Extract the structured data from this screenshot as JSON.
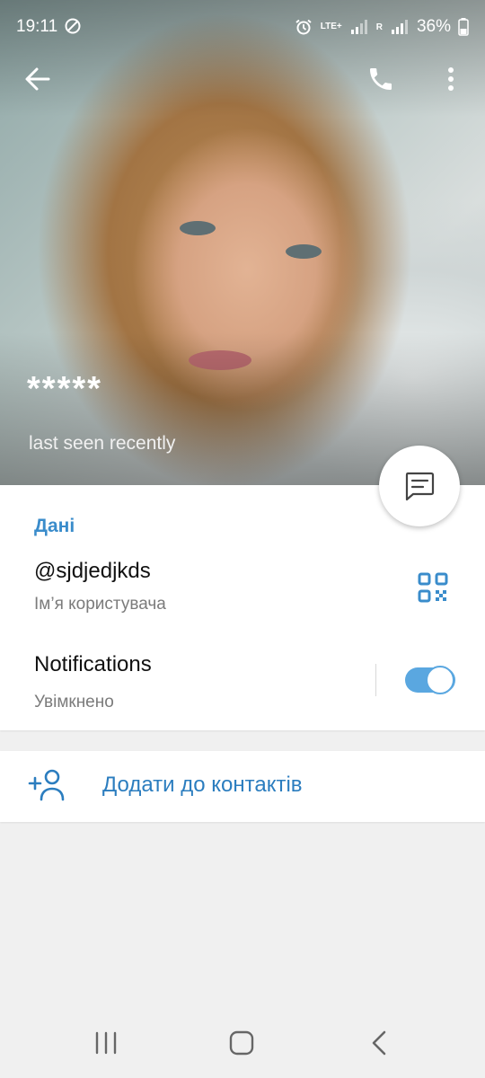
{
  "status_bar": {
    "time": "19:11",
    "network_label": "LTE+",
    "roaming_label": "R",
    "battery_percent": "36%",
    "icons": [
      "do-not-disturb-icon",
      "alarm-icon",
      "signal-icon",
      "battery-icon"
    ]
  },
  "toolbar": {
    "back_icon": "arrow-left-icon",
    "call_icon": "phone-icon",
    "more_icon": "more-vertical-icon"
  },
  "profile": {
    "name": "*****",
    "status": "last seen recently",
    "message_icon": "message-icon"
  },
  "info": {
    "section_title": "Дані",
    "username": "@sjdjedjkds",
    "username_caption": "Ім’я користувача",
    "qr_icon": "qr-code-icon",
    "notifications_label": "Notifications",
    "notifications_state": "Увімкнено",
    "notifications_on": true
  },
  "actions": {
    "add_contact_label": "Додати до контактів",
    "add_contact_icon": "add-user-icon"
  },
  "colors": {
    "accent": "#3a8ccb",
    "toggle_on": "#5aa7e0",
    "background": "#f0f0f0"
  }
}
